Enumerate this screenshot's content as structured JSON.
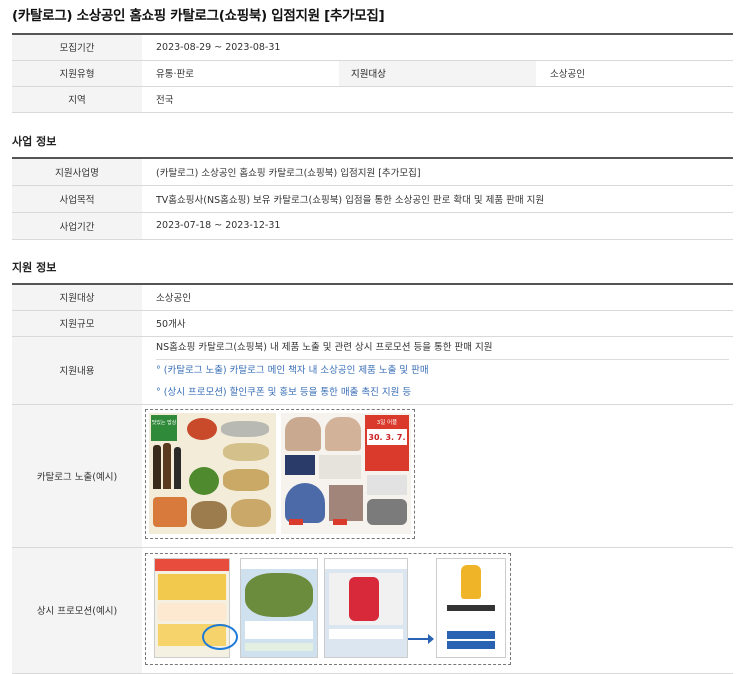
{
  "page_title": "(카탈로그) 소상공인 홈쇼핑 카탈로그(쇼핑북) 입점지원 [추가모집]",
  "summary": {
    "period_label": "모집기간",
    "period_value": "2023-08-29 ~ 2023-08-31",
    "type_label": "지원유형",
    "type_value": "유통·판로",
    "target_label": "지원대상",
    "target_value": "소상공인",
    "region_label": "지역",
    "region_value": "전국"
  },
  "business_info": {
    "heading": "사업 정보",
    "name_label": "지원사업명",
    "name_value": "(카탈로그) 소상공인 홈쇼핑 카탈로그(쇼핑북) 입점지원 [추가모집]",
    "purpose_label": "사업목적",
    "purpose_value": "TV홈쇼핑사(NS홈쇼핑) 보유 카탈로그(쇼핑북) 입점을 통한 소상공인 판로 확대 및 제품 판매 지원",
    "period_label": "사업기간",
    "period_value": "2023-07-18 ~ 2023-12-31"
  },
  "support_info": {
    "heading": "지원 정보",
    "target_label": "지원대상",
    "target_value": "소상공인",
    "scale_label": "지원규모",
    "scale_value": "50개사",
    "content_label": "지원내용",
    "content_main": "NS홈쇼핑 카탈로그(쇼핑북) 내 제품 노출 및 관련 상시 프로모션 등을 통한 판매 지원",
    "content_bullet1": "° (카탈로그 노출) 카탈로그 메인 책자 내 소상공인 제품 노출 및 판매",
    "content_bullet2": "° (상시 프로모션) 할인쿠폰 및 홍보 등을 통한 매출 촉진 지원 등",
    "catalog_label": "카탈로그 노출(예시)",
    "promo_label": "상시 프로모션(예시)"
  },
  "catalog_images": {
    "left_badge": "맛있는 밥상",
    "right_tag": "3일 어플",
    "right_numbers": [
      "30.",
      "3.",
      "7."
    ]
  },
  "colors": {
    "header_bg": "#f4f4f4",
    "border": "#d9d9d9",
    "accent_link": "#3b6fb6"
  }
}
